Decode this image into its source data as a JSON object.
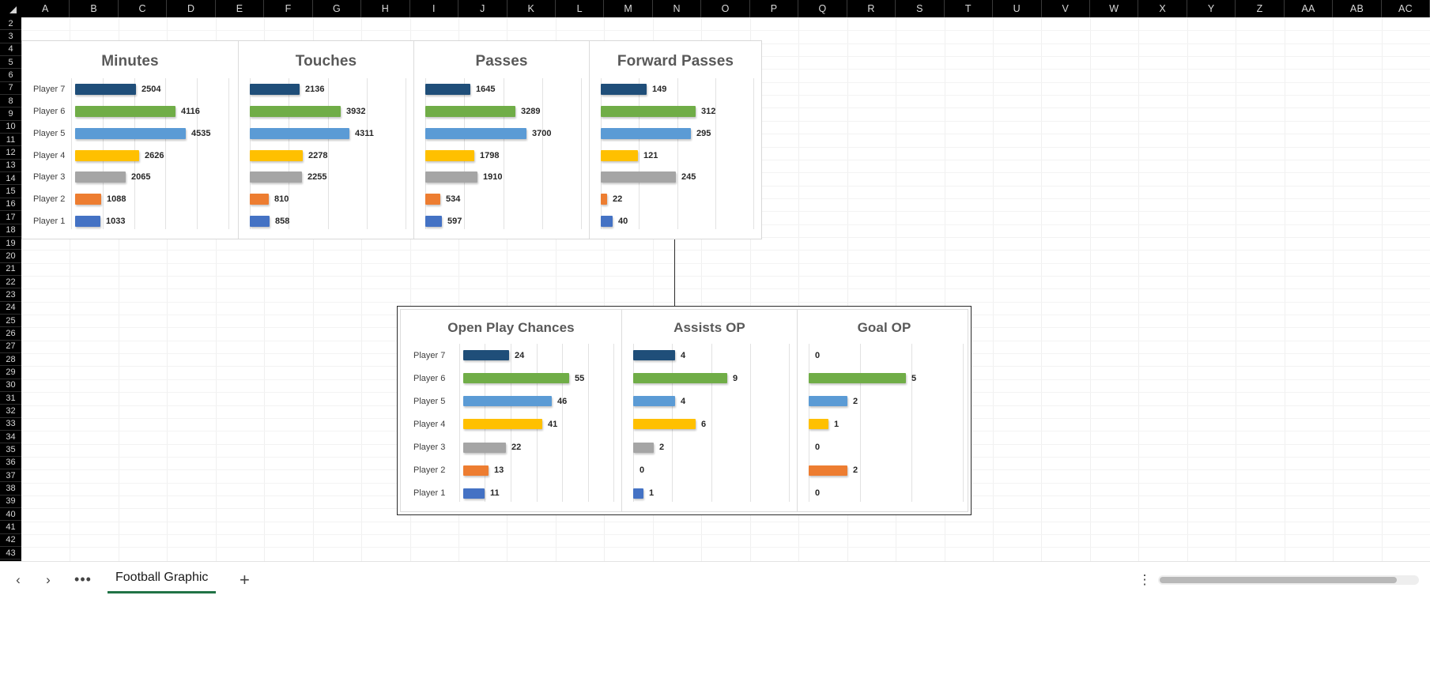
{
  "window": {
    "sheet_tab": "Football Graphic",
    "add_sheet_label": "+",
    "prev_label": "‹",
    "next_label": "›",
    "more_label": "•••",
    "kebab_label": "⋮"
  },
  "grid": {
    "columns": [
      "A",
      "B",
      "C",
      "D",
      "E",
      "F",
      "G",
      "H",
      "I",
      "J",
      "K",
      "L",
      "M",
      "N",
      "O",
      "P",
      "Q",
      "R",
      "S",
      "T",
      "U",
      "V",
      "W",
      "X",
      "Y",
      "Z",
      "AA",
      "AB",
      "AC"
    ],
    "rows": [
      2,
      3,
      4,
      5,
      6,
      7,
      8,
      9,
      10,
      11,
      12,
      13,
      14,
      15,
      16,
      17,
      18,
      19,
      20,
      21,
      22,
      23,
      24,
      25,
      26,
      27,
      28,
      29,
      30,
      31,
      32,
      33,
      34,
      35,
      36,
      37,
      38,
      39,
      40,
      41,
      42,
      43
    ]
  },
  "colors": {
    "player7": "#1F4E79",
    "player6": "#70AD47",
    "player5": "#5B9BD5",
    "player4": "#FFC000",
    "player3": "#A5A5A5",
    "player2": "#ED7D31",
    "player1": "#4472C4",
    "accent_green": "#217346",
    "title_text": "#595959"
  },
  "chart_data": [
    {
      "type": "bar",
      "title": "Minutes",
      "orientation": "horizontal",
      "categories": [
        "Player 7",
        "Player 6",
        "Player 5",
        "Player 4",
        "Player 3",
        "Player 2",
        "Player 1"
      ],
      "values": [
        2504,
        4116,
        4535,
        2626,
        2065,
        1088,
        1033
      ],
      "colors": [
        "#1F4E79",
        "#70AD47",
        "#5B9BD5",
        "#FFC000",
        "#A5A5A5",
        "#ED7D31",
        "#4472C4"
      ],
      "xlabel": "",
      "ylabel": "",
      "xlim": [
        0,
        5200
      ],
      "grid": true,
      "show_category_labels": true,
      "data_labels": true,
      "group": "top"
    },
    {
      "type": "bar",
      "title": "Touches",
      "orientation": "horizontal",
      "categories": [
        "Player 7",
        "Player 6",
        "Player 5",
        "Player 4",
        "Player 3",
        "Player 2",
        "Player 1"
      ],
      "values": [
        2136,
        3932,
        4311,
        2278,
        2255,
        810,
        858
      ],
      "colors": [
        "#1F4E79",
        "#70AD47",
        "#5B9BD5",
        "#FFC000",
        "#A5A5A5",
        "#ED7D31",
        "#4472C4"
      ],
      "xlabel": "",
      "ylabel": "",
      "xlim": [
        0,
        5200
      ],
      "grid": true,
      "show_category_labels": false,
      "data_labels": true,
      "group": "top"
    },
    {
      "type": "bar",
      "title": "Passes",
      "orientation": "horizontal",
      "categories": [
        "Player 7",
        "Player 6",
        "Player 5",
        "Player 4",
        "Player 3",
        "Player 2",
        "Player 1"
      ],
      "values": [
        1645,
        3289,
        3700,
        1798,
        1910,
        534,
        597
      ],
      "colors": [
        "#1F4E79",
        "#70AD47",
        "#5B9BD5",
        "#FFC000",
        "#A5A5A5",
        "#ED7D31",
        "#4472C4"
      ],
      "xlabel": "",
      "ylabel": "",
      "xlim": [
        0,
        4400
      ],
      "grid": true,
      "show_category_labels": false,
      "data_labels": true,
      "group": "top"
    },
    {
      "type": "bar",
      "title": "Forward Passes",
      "orientation": "horizontal",
      "categories": [
        "Player 7",
        "Player 6",
        "Player 5",
        "Player 4",
        "Player 3",
        "Player 2",
        "Player 1"
      ],
      "values": [
        149,
        312,
        295,
        121,
        245,
        22,
        40
      ],
      "colors": [
        "#1F4E79",
        "#70AD47",
        "#5B9BD5",
        "#FFC000",
        "#A5A5A5",
        "#ED7D31",
        "#4472C4"
      ],
      "xlabel": "",
      "ylabel": "",
      "xlim": [
        0,
        380
      ],
      "grid": true,
      "show_category_labels": false,
      "data_labels": true,
      "group": "top"
    },
    {
      "type": "bar",
      "title": "Open Play Chances",
      "orientation": "horizontal",
      "categories": [
        "Player 7",
        "Player 6",
        "Player 5",
        "Player 4",
        "Player 3",
        "Player 2",
        "Player 1"
      ],
      "values": [
        24,
        55,
        46,
        41,
        22,
        13,
        11
      ],
      "colors": [
        "#1F4E79",
        "#70AD47",
        "#5B9BD5",
        "#FFC000",
        "#A5A5A5",
        "#ED7D31",
        "#4472C4"
      ],
      "xlabel": "",
      "ylabel": "",
      "xlim": [
        0,
        66
      ],
      "grid": true,
      "show_category_labels": true,
      "data_labels": true,
      "group": "bottom"
    },
    {
      "type": "bar",
      "title": "Assists OP",
      "orientation": "horizontal",
      "categories": [
        "Player 7",
        "Player 6",
        "Player 5",
        "Player 4",
        "Player 3",
        "Player 2",
        "Player 1"
      ],
      "values": [
        4,
        9,
        4,
        6,
        2,
        0,
        1
      ],
      "colors": [
        "#1F4E79",
        "#70AD47",
        "#5B9BD5",
        "#FFC000",
        "#A5A5A5",
        "#ED7D31",
        "#4472C4"
      ],
      "xlabel": "",
      "ylabel": "",
      "xlim": [
        0,
        12
      ],
      "grid": true,
      "show_category_labels": false,
      "data_labels": true,
      "group": "bottom"
    },
    {
      "type": "bar",
      "title": "Goal OP",
      "orientation": "horizontal",
      "categories": [
        "Player 7",
        "Player 6",
        "Player 5",
        "Player 4",
        "Player 3",
        "Player 2",
        "Player 1"
      ],
      "values": [
        0,
        5,
        2,
        1,
        0,
        2,
        0
      ],
      "colors": [
        "#1F4E79",
        "#70AD47",
        "#5B9BD5",
        "#FFC000",
        "#A5A5A5",
        "#ED7D31",
        "#4472C4"
      ],
      "xlabel": "",
      "ylabel": "",
      "xlim": [
        0,
        6.2
      ],
      "grid": true,
      "show_category_labels": false,
      "data_labels": true,
      "group": "bottom"
    }
  ]
}
